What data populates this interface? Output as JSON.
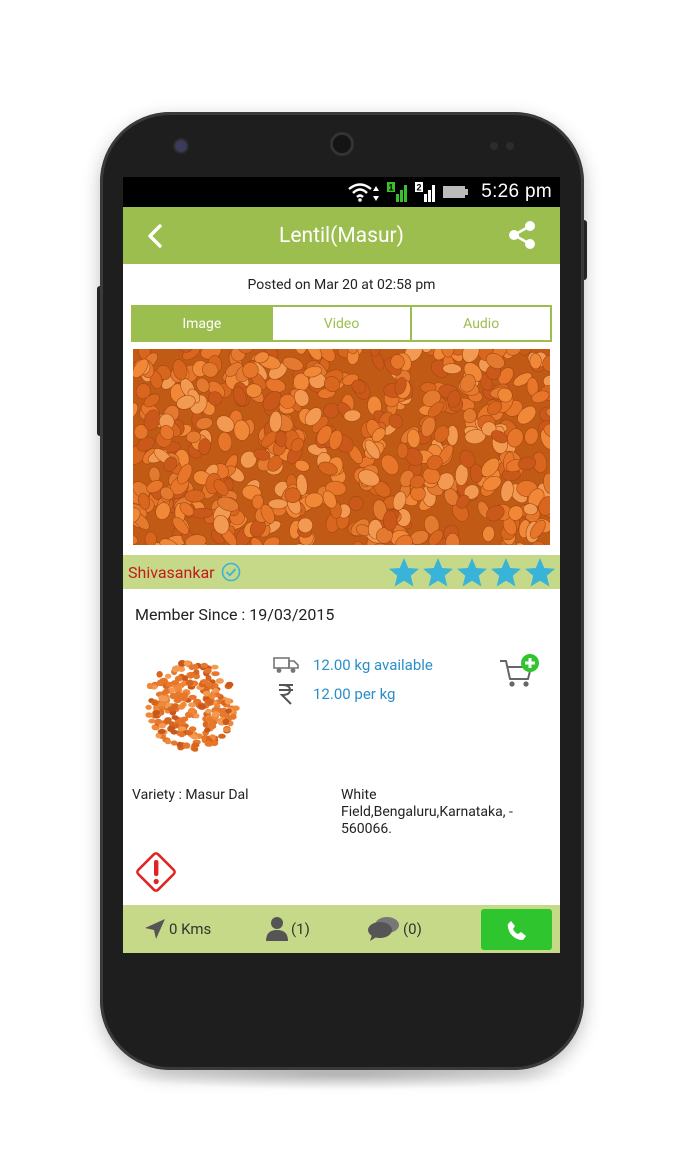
{
  "status_bar": {
    "time": "5:26 pm",
    "sim1_label": "1",
    "sim2_label": "2",
    "icons": [
      "wifi-icon",
      "sim1-signal-icon",
      "sim2-signal-icon",
      "battery-icon"
    ]
  },
  "toolbar": {
    "title": "Lentil(Masur)",
    "back_icon": "chevron-left-icon",
    "share_icon": "share-icon"
  },
  "post": {
    "posted_text": "Posted on Mar 20 at 02:58 pm"
  },
  "media_tabs": [
    {
      "label": "Image",
      "active": true
    },
    {
      "label": "Video",
      "active": false
    },
    {
      "label": "Audio",
      "active": false
    }
  ],
  "seller": {
    "name": "Shivasankar",
    "verified_icon": "check-circle-icon",
    "rating": 5,
    "rating_max": 5,
    "member_since": "Member Since : 19/03/2015"
  },
  "product": {
    "quantity": "12.00 kg available",
    "price": "12.00 per kg",
    "variety": "Variety : Masur Dal",
    "address": "White Field,Bengaluru,Karnataka, - 560066."
  },
  "bottom_bar": {
    "distance": "0 Kms",
    "followers": "(1)",
    "comments": "(0)"
  },
  "colors": {
    "accent_green": "#9cbe4e",
    "light_green": "#c6d989",
    "seller_red": "#c21b1b",
    "info_blue": "#2a8fc7",
    "star_blue": "#39b4d8",
    "call_green": "#2ec52e",
    "report_red": "#e02424"
  }
}
